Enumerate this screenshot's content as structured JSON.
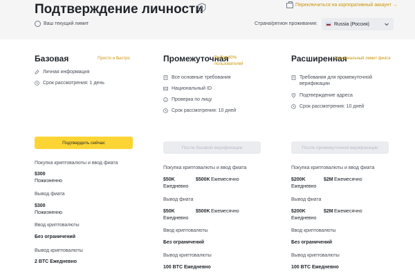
{
  "header": {
    "title": "Подтверждение личности",
    "corporate_link": "Переключиться на корпоративный аккаунт →",
    "current_limit": "Ваш текущий лимит",
    "region_label": "Страна/регион проживания:",
    "region_value": "Russia (Россия)"
  },
  "levels": [
    {
      "title": "Базовая",
      "tag": "Просто и быстро",
      "features": [
        "Личная информация",
        "Срок рассмотрения: 1 день"
      ],
      "button": "Подтвердить сейчас",
      "limits": {
        "buy_label": "Покупка криптовалюты и ввод фиата",
        "buy_value": "$300",
        "buy_period": "Пожизненно",
        "withdraw_label": "Вывод фиата",
        "withdraw_value": "$300",
        "withdraw_period": "Пожизненно",
        "crypto_in_label": "Ввод криптовалюты",
        "crypto_in_value": "Без ограничений",
        "crypto_out_label": "Вывод криптовалюты",
        "crypto_out_value": "2 BTC Ежедневно"
      }
    },
    {
      "title": "Промежуточная",
      "tag": "Выбор 80% пользователей",
      "features": [
        "Все основные требования",
        "Национальный ID",
        "Проверка по лицу",
        "Срок рассмотрения: 10 дней"
      ],
      "button": "После базовой верификации",
      "limits": {
        "buy_label": "Покупка криптовалюты и ввод фиата",
        "buy_daily": "$50K",
        "buy_daily_period": "Ежедневно",
        "buy_monthly": "$500K",
        "buy_monthly_period": "Ежемесячно",
        "withdraw_label": "Вывод фиата",
        "withdraw_daily": "$50K",
        "withdraw_daily_period": "Ежедневно",
        "withdraw_monthly": "$500K",
        "withdraw_monthly_period": "Ежемесячно",
        "crypto_in_label": "Ввод криптовалюты",
        "crypto_in_value": "Без ограничений",
        "crypto_out_label": "Вывод криптовалюты",
        "crypto_out_value": "100 BTC Ежедневно"
      }
    },
    {
      "title": "Расширенная",
      "tag": "Максимальный лимит фиата",
      "features": [
        "Требования для промежуточной верификации",
        "Подтверждение адреса",
        "Срок рассмотрения: 10 дней"
      ],
      "button": "После промежуточной верификации",
      "limits": {
        "buy_label": "Покупка криптовалюты и ввод фиата",
        "buy_daily": "$200K",
        "buy_daily_period": "Ежедневно",
        "buy_monthly": "$2M",
        "buy_monthly_period": "Ежемесячно",
        "withdraw_label": "Вывод фиата",
        "withdraw_daily": "$200K",
        "withdraw_daily_period": "Ежедневно",
        "withdraw_monthly": "$2M",
        "withdraw_monthly_period": "Ежемесячно",
        "crypto_in_label": "Ввод криптовалюты",
        "crypto_in_value": "Без ограничений",
        "crypto_out_label": "Вывод криптовалюты",
        "crypto_out_value": "100 BTC Ежедневно"
      }
    }
  ],
  "colors": {
    "accent": "#fcd535",
    "link": "#c99400",
    "header_bg": "#f5f5f5",
    "disabled_bg": "#eaecef"
  },
  "icons": [
    "shield-icon",
    "briefcase-icon",
    "info-circle-icon",
    "russia-flag-icon",
    "chevron-down-icon",
    "edit-icon",
    "clock-icon",
    "id-card-icon",
    "face-icon",
    "location-icon",
    "document-icon"
  ]
}
